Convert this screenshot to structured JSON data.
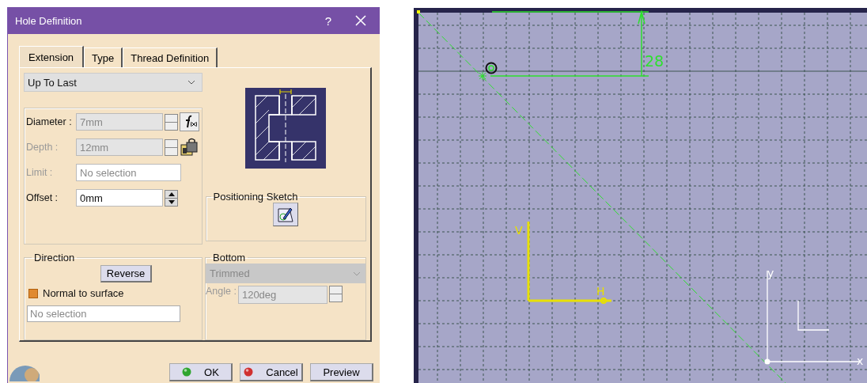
{
  "dialog": {
    "title": "Hole Definition",
    "help": "?"
  },
  "tabs": [
    {
      "label": "Extension",
      "selected": true
    },
    {
      "label": "Type",
      "selected": false
    },
    {
      "label": "Thread Definition",
      "selected": false
    }
  ],
  "extension": {
    "value": "Up To Last"
  },
  "fields": [
    {
      "label": "Diameter :",
      "kind": "spinner",
      "value": "7mm",
      "disabled": false,
      "readonly": true,
      "tool": {
        "kind": "formula"
      }
    },
    {
      "label": "Depth :",
      "kind": "spinner",
      "value": "12mm",
      "disabled": true,
      "readonly": true,
      "tool": {
        "kind": "lock"
      }
    },
    {
      "label": "Limit :",
      "kind": "text",
      "placeholder": "No selection",
      "disabled": true,
      "readonly": false
    },
    {
      "label": "Offset :",
      "kind": "spinner",
      "value": "0mm",
      "disabled": false,
      "readonly": false
    }
  ],
  "positioning_sketch": {
    "title": "Positioning Sketch"
  },
  "direction": {
    "title": "Direction",
    "reverse": "Reverse",
    "normal": {
      "label": "Normal to surface",
      "checked": true
    },
    "placeholder": "No selection"
  },
  "bottom": {
    "title": "Bottom",
    "type": {
      "value": "Trimmed",
      "disabled": true
    },
    "angle": {
      "label": "Angle :",
      "value": "120deg"
    }
  },
  "buttons": [
    {
      "label": "OK",
      "kind": "ok"
    },
    {
      "label": "Cancel",
      "kind": "cancel"
    },
    {
      "label": "Preview",
      "kind": "preview"
    }
  ],
  "sketch": {
    "dimension": "28",
    "v_axis": "V",
    "h_axis": "H",
    "compass_y": "y",
    "compass_x": "x"
  }
}
